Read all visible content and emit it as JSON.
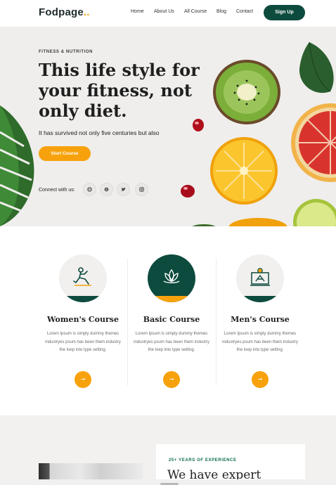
{
  "header": {
    "logo_text": "Fodpage",
    "logo_dot": "..",
    "nav": [
      "Home",
      "About Us",
      "All Course",
      "Blog",
      "Contact"
    ],
    "signup_label": "Sign Up"
  },
  "hero": {
    "eyebrow": "FITNESS & NUTRITION",
    "title": "This life style for\nyour fitness, not\nonly diet.",
    "subtitle": "It has survived not only five centuries but also",
    "cta_label": "Start Course",
    "connect_label": "Connect with us:",
    "social_icons": [
      "dribbble-icon",
      "skype-icon",
      "twitter-icon",
      "instagram-icon"
    ]
  },
  "courses": [
    {
      "title": "Women's Course",
      "desc": "Lorem Ipsum is simply dummy themes industryes psum has been them industry the loep into type setting.",
      "icon": "yoga-pose-icon"
    },
    {
      "title": "Basic Course",
      "desc": "Lorem Ipsum is simply dummy themes industryes psum has been them industry the loep into type setting.",
      "icon": "lotus-icon"
    },
    {
      "title": "Men's Course",
      "desc": "Lorem Ipsum is simply dummy themes industryes psum has been them industry the loep into type setting.",
      "icon": "meditation-screen-icon"
    }
  ],
  "about": {
    "experience_label": "25+ YEARS OF EXPERIENCE",
    "title": "We have expert"
  },
  "colors": {
    "brand_green": "#0d4b3e",
    "accent_orange": "#f7a20c",
    "hero_bg": "#efeeec"
  }
}
